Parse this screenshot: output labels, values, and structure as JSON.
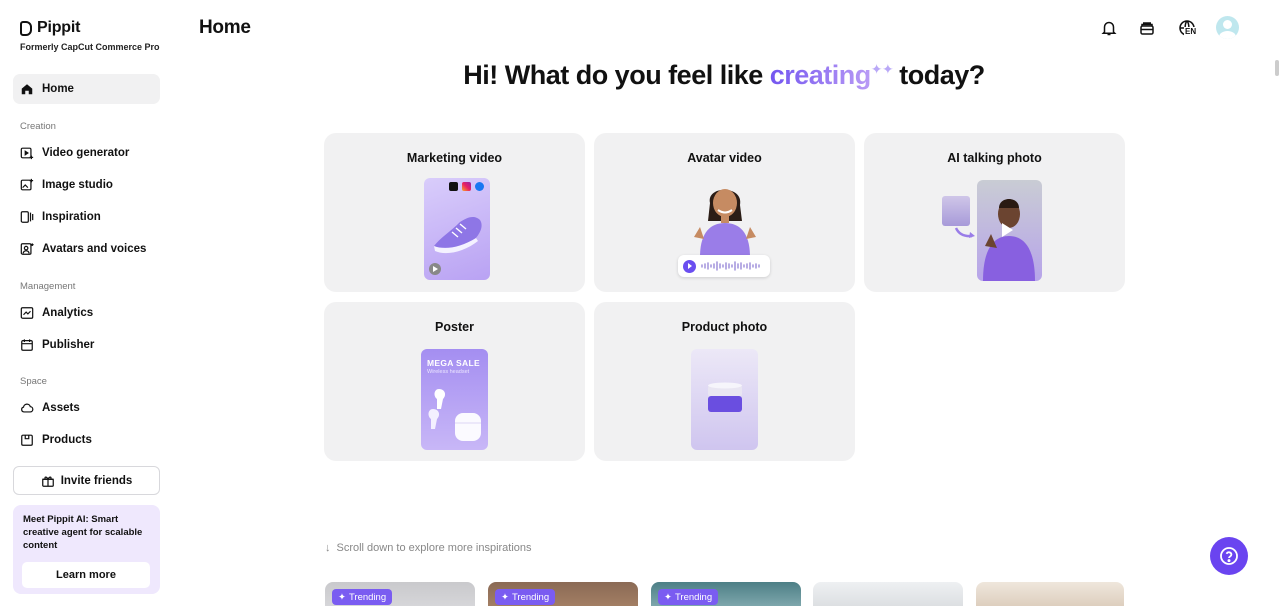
{
  "brand": {
    "name": "Pippit",
    "subtitle": "Formerly CapCut Commerce Pro"
  },
  "sidebar": {
    "home": "Home",
    "sections": {
      "creation": "Creation",
      "management": "Management",
      "space": "Space"
    },
    "creation_items": [
      {
        "label": "Video generator",
        "icon": "video-plus-icon"
      },
      {
        "label": "Image studio",
        "icon": "image-plus-icon"
      },
      {
        "label": "Inspiration",
        "icon": "inspiration-icon"
      },
      {
        "label": "Avatars and voices",
        "icon": "avatar-icon"
      }
    ],
    "management_items": [
      {
        "label": "Analytics",
        "icon": "analytics-icon"
      },
      {
        "label": "Publisher",
        "icon": "calendar-icon"
      }
    ],
    "space_items": [
      {
        "label": "Assets",
        "icon": "cloud-icon"
      },
      {
        "label": "Products",
        "icon": "box-icon"
      }
    ],
    "invite_label": "Invite friends",
    "promo": {
      "text": "Meet Pippit AI: Smart creative agent for scalable content",
      "button": "Learn more"
    }
  },
  "header": {
    "title": "Home",
    "lang": "EN"
  },
  "hero": {
    "prefix": "Hi! What do you feel like ",
    "accent": "creating",
    "suffix": "today?"
  },
  "cards": [
    {
      "title": "Marketing video"
    },
    {
      "title": "Avatar video"
    },
    {
      "title": "AI talking photo"
    },
    {
      "title": "Poster",
      "poster_title": "MEGA SALE",
      "poster_subtitle": "Wireless headset"
    },
    {
      "title": "Product photo"
    }
  ],
  "scroll_hint": "Scroll down to explore more inspirations",
  "trending_label": "Trending",
  "colors": {
    "accent": "#6a44f0",
    "card_bg": "#f1f1f2",
    "promo_bg": "#efe8fd"
  }
}
